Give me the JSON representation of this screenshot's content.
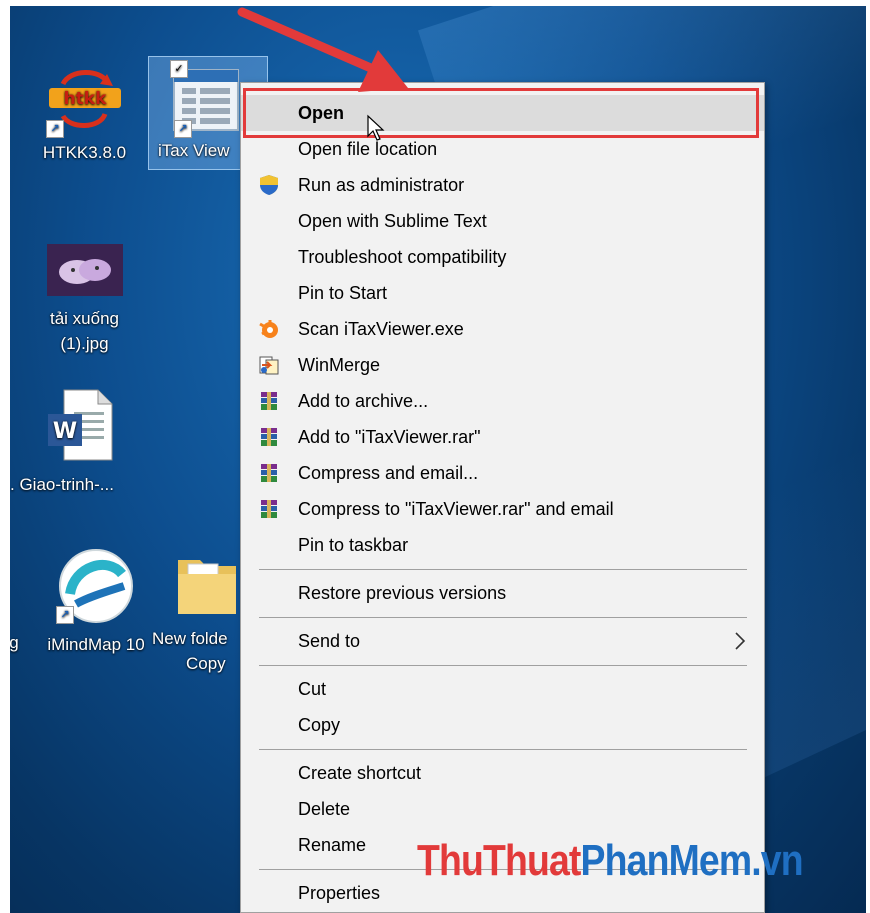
{
  "desktop": {
    "icons": [
      {
        "label": "HTKK3.8.0"
      },
      {
        "label": "iTax View"
      },
      {
        "label_line1": "tải xuống",
        "label_line2": "(1).jpg"
      },
      {
        "label": ". Giao-trinh-..."
      },
      {
        "label": "iMindMap 10"
      },
      {
        "label_line1": "New folde",
        "label_line2": "Copy"
      },
      {
        "label": "g"
      }
    ]
  },
  "context_menu": {
    "items": [
      {
        "label": "Open",
        "icon": null,
        "bold": true,
        "highlighted": true
      },
      {
        "label": "Open file location",
        "icon": null
      },
      {
        "label": "Run as administrator",
        "icon": "uac-shield-icon"
      },
      {
        "label": "Open with Sublime Text",
        "icon": null
      },
      {
        "label": "Troubleshoot compatibility",
        "icon": null
      },
      {
        "label": "Pin to Start",
        "icon": null
      },
      {
        "label": "Scan iTaxViewer.exe",
        "icon": "avast-icon"
      },
      {
        "label": "WinMerge",
        "icon": "winmerge-icon"
      },
      {
        "label": "Add to archive...",
        "icon": "winrar-icon"
      },
      {
        "label": "Add to \"iTaxViewer.rar\"",
        "icon": "winrar-icon"
      },
      {
        "label": "Compress and email...",
        "icon": "winrar-icon"
      },
      {
        "label": "Compress to \"iTaxViewer.rar\" and email",
        "icon": "winrar-icon"
      },
      {
        "label": "Pin to taskbar",
        "icon": null
      },
      {
        "label": "Restore previous versions",
        "icon": null
      },
      {
        "label": "Send to",
        "icon": null,
        "submenu": true
      },
      {
        "label": "Cut",
        "icon": null
      },
      {
        "label": "Copy",
        "icon": null
      },
      {
        "label": "Create shortcut",
        "icon": null
      },
      {
        "label": "Delete",
        "icon": null
      },
      {
        "label": "Rename",
        "icon": null
      },
      {
        "label": "Properties",
        "icon": null
      }
    ]
  },
  "watermark": {
    "part1": "ThuThuat",
    "part2": "PhanMem.vn"
  },
  "colors": {
    "highlight": "#e23a3a",
    "menu_bg": "#f2f2f2",
    "desktop": "#0d4e8f",
    "watermark_blue": "#1f6fc2"
  }
}
